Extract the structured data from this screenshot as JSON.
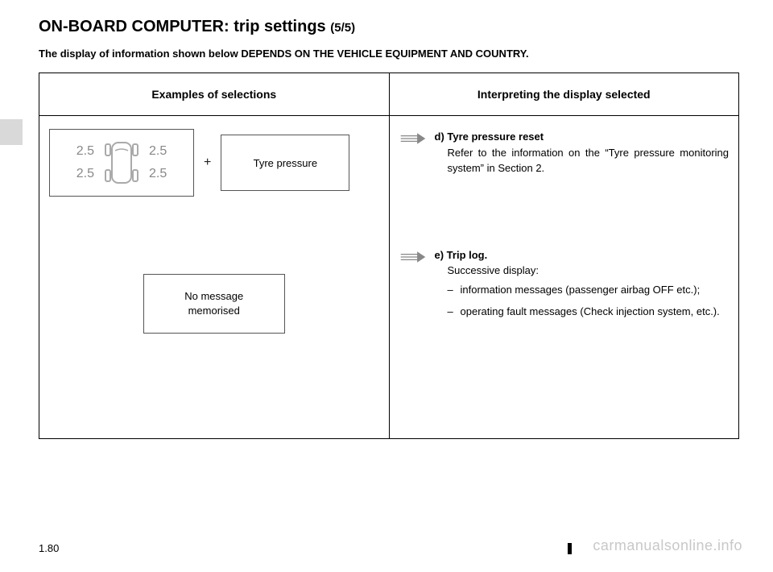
{
  "title_main": "ON-BOARD COMPUTER: trip settings",
  "title_sub": "(5/5)",
  "notice": "The display of information shown below DEPENDS ON THE VEHICLE EQUIPMENT AND COUNTRY.",
  "table": {
    "header_left": "Examples of selections",
    "header_right": "Interpreting the display selected",
    "tyre_values": {
      "fl": "2.5",
      "rl": "2.5",
      "fr": "2.5",
      "rr": "2.5"
    },
    "plus": "+",
    "tyre_label": "Tyre pressure",
    "no_msg_line1": "No message",
    "no_msg_line2": "memorised",
    "entries": {
      "d": {
        "label": "d) Tyre pressure reset",
        "text": "Refer to the information on the “Tyre pressure monitoring system” in Section 2."
      },
      "e": {
        "label": "e) Trip log.",
        "sub": "Successive display:",
        "items": [
          "information messages (passenger airbag OFF etc.);",
          "operating fault messages (Check injection system, etc.)."
        ]
      }
    }
  },
  "page_number": "1.80",
  "watermark": "carmanualsonline.info"
}
